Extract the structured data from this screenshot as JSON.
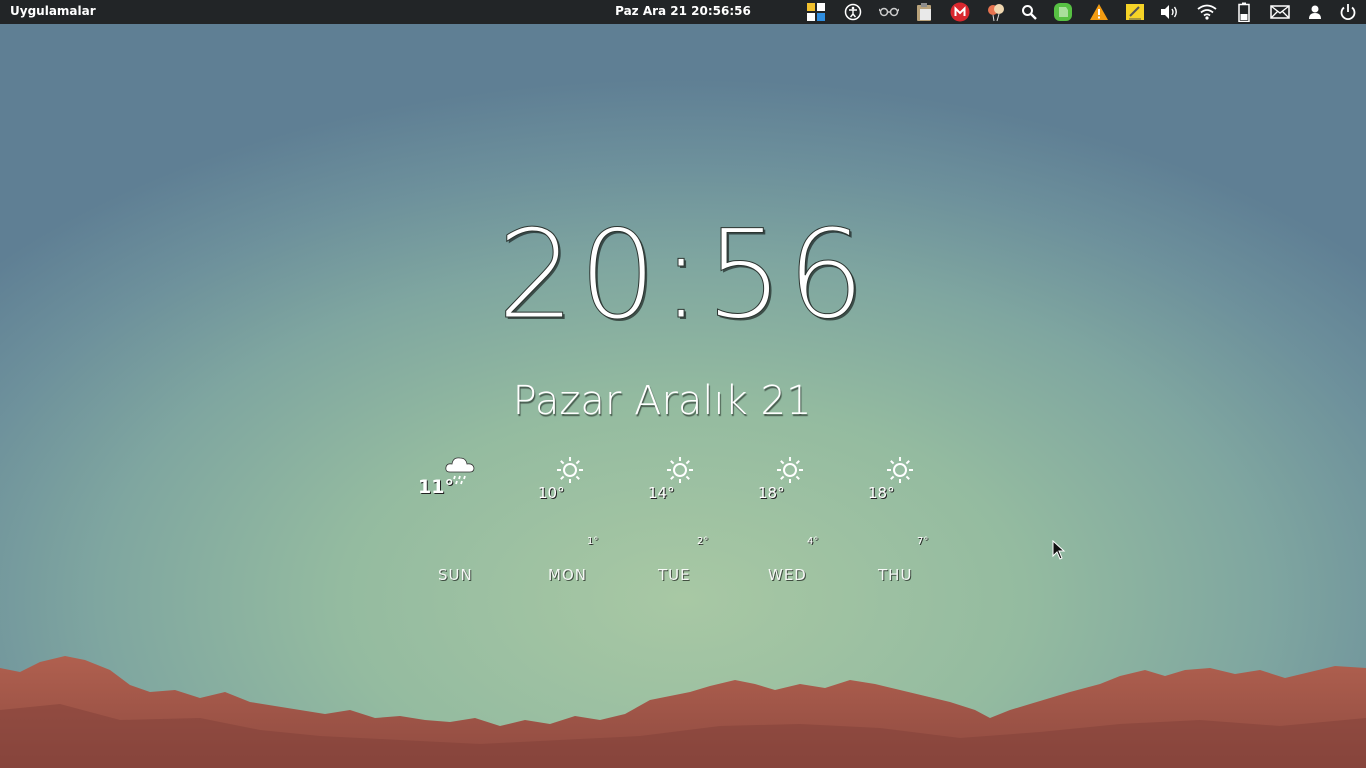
{
  "panel": {
    "applications_label": "Uygulamalar",
    "datetime": "Paz Ara 21 20:56:56",
    "tray_icons": [
      "workspace-switcher-icon",
      "accessibility-icon",
      "glasses-icon",
      "clipboard-icon",
      "mega-sync-icon",
      "balloons-icon",
      "search-icon",
      "evernote-icon",
      "warning-icon",
      "notes-icon",
      "volume-icon",
      "wifi-icon",
      "battery-icon",
      "mail-icon",
      "user-icon",
      "power-icon"
    ]
  },
  "desktop_widget": {
    "time": "20:56",
    "date": "Pazar Aralık 21",
    "forecast": [
      {
        "day": "SUN",
        "high": "11°",
        "low": "",
        "icon": "rain-cloud-icon"
      },
      {
        "day": "MON",
        "high": "10°",
        "low": "1°",
        "icon": "sun-icon"
      },
      {
        "day": "TUE",
        "high": "14°",
        "low": "2°",
        "icon": "sun-icon"
      },
      {
        "day": "WED",
        "high": "18°",
        "low": "4°",
        "icon": "sun-icon"
      },
      {
        "day": "THU",
        "high": "18°",
        "low": "7°",
        "icon": "sun-icon"
      }
    ]
  },
  "colors": {
    "panel_bg": "#222527",
    "sky_top": "#5f7f94",
    "sky_bottom": "#a8c8a4",
    "mountain": "#a2574a"
  }
}
